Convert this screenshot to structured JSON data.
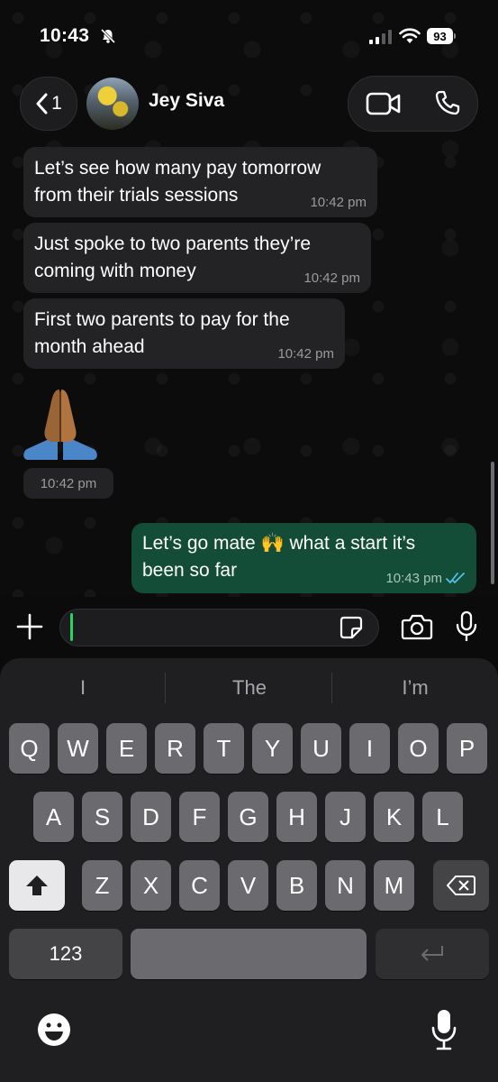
{
  "status_bar": {
    "time": "10:43",
    "battery": "93"
  },
  "header": {
    "back_count": "1",
    "contact_name": "Jey Siva"
  },
  "messages": [
    {
      "direction": "in",
      "text": "Let’s see how many pay tomorrow\nfrom their trials sessions",
      "time": "10:42 pm"
    },
    {
      "direction": "in",
      "text": "Just spoke to two parents they’re\ncoming with money",
      "time": "10:42 pm"
    },
    {
      "direction": "in",
      "text": "First two parents to pay for the\nmonth ahead",
      "time": "10:42 pm"
    },
    {
      "direction": "in",
      "text": "🙏🏾",
      "time": "10:42 pm"
    },
    {
      "direction": "out",
      "text": "Let’s go mate 🙌 what a start it’s\nbeen so far",
      "time": "10:43 pm",
      "status": "read"
    }
  ],
  "input": {
    "placeholder": ""
  },
  "keyboard": {
    "suggestions": [
      "I",
      "The",
      "I’m"
    ],
    "row1": [
      "Q",
      "W",
      "E",
      "R",
      "T",
      "Y",
      "U",
      "I",
      "O",
      "P"
    ],
    "row2": [
      "A",
      "S",
      "D",
      "F",
      "G",
      "H",
      "J",
      "K",
      "L"
    ],
    "row3": [
      "Z",
      "X",
      "C",
      "V",
      "B",
      "N",
      "M"
    ],
    "numbers_label": "123"
  },
  "colors": {
    "outgoing_bubble": "#134d37",
    "incoming_bubble": "#232325",
    "accent": "#25d366",
    "read_ticks": "#53bdeb"
  },
  "icons": [
    "bell-slash-icon",
    "signal-icon",
    "wifi-icon",
    "battery-icon",
    "chevron-left-icon",
    "video-call-icon",
    "phone-icon",
    "plus-icon",
    "sticker-icon",
    "camera-icon",
    "microphone-icon",
    "shift-icon",
    "delete-icon",
    "return-icon",
    "emoji-icon",
    "dictation-icon"
  ]
}
